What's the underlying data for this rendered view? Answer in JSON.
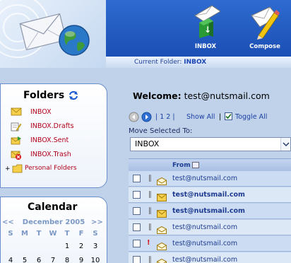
{
  "header": {
    "inbox_label": "INBOX",
    "compose_label": "Compose",
    "current_folder_label": "Current Folder:",
    "current_folder_value": "INBOX"
  },
  "folders": {
    "title": "Folders",
    "items": [
      {
        "label": "INBOX",
        "icon": "envelope-icon"
      },
      {
        "label": "INBOX.Drafts",
        "icon": "drafts-icon"
      },
      {
        "label": "INBOX.Sent",
        "icon": "sent-icon"
      },
      {
        "label": "INBOX.Trash",
        "icon": "trash-icon"
      },
      {
        "label": "Personal Folders",
        "icon": "folder-icon",
        "expander": "+"
      }
    ]
  },
  "calendar": {
    "title": "Calendar",
    "prev": "<<",
    "next": ">>",
    "month": "December 2005",
    "days": [
      "S",
      "M",
      "T",
      "W",
      "T",
      "F",
      "S"
    ],
    "weeks": [
      [
        "",
        "",
        "",
        "",
        "1",
        "2",
        "3"
      ],
      [
        "4",
        "5",
        "6",
        "7",
        "8",
        "9",
        "10"
      ]
    ]
  },
  "main": {
    "welcome_label": "Welcome:",
    "welcome_user": "test@nutsmail.com",
    "pages": "| 1 2 |",
    "show_all": "Show All",
    "separator": "|",
    "toggle_all": "Toggle All",
    "move_label": "Move Selected To:",
    "move_value": "INBOX",
    "from_header": "From",
    "messages": [
      {
        "from": "test@nutsmail.com",
        "unread": false,
        "attachment": true,
        "priority": false
      },
      {
        "from": "test@nutsmail.com",
        "unread": true,
        "attachment": true,
        "priority": false
      },
      {
        "from": "test@nutsmail.com",
        "unread": true,
        "attachment": true,
        "priority": false
      },
      {
        "from": "test@nutsmail.com",
        "unread": false,
        "attachment": true,
        "priority": false
      },
      {
        "from": "test@nutsmail.com",
        "unread": false,
        "attachment": false,
        "priority": true
      },
      {
        "from": "test@nutsmail.com",
        "unread": false,
        "attachment": true,
        "priority": false
      }
    ]
  },
  "colors": {
    "header_blue": "#1f55bf",
    "folder_red": "#b00018",
    "link_blue": "#1c3fa2",
    "background": "#bfd2ea"
  }
}
